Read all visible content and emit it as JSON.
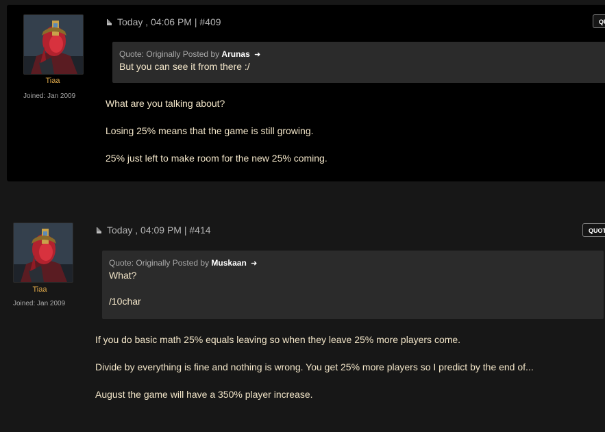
{
  "posts": [
    {
      "username": "Tiaa",
      "joined": "Joined: Jan 2009",
      "meta": "Today , 04:06 PM | #409",
      "quote_button": "QU",
      "quote": {
        "prefix": "Quote: Originally Posted by",
        "author": "Arunas",
        "lines": [
          "But you can see it from there :/"
        ]
      },
      "body": [
        "What are you talking about?",
        "Losing 25% means that the game is still growing.",
        "25% just left to make room for the new 25% coming."
      ]
    },
    {
      "username": "Tiaa",
      "joined": "Joined: Jan 2009",
      "meta": "Today , 04:09 PM | #414",
      "quote_button": "QUOTE",
      "quote": {
        "prefix": "Quote: Originally Posted by",
        "author": "Muskaan",
        "lines": [
          "What?",
          "/10char"
        ]
      },
      "body": [
        "If you do basic math 25% equals leaving so when they leave 25% more players come.",
        "Divide by everything is fine and nothing is wrong. You get 25% more players so I predict by the end of...",
        "August the game will have a 350% player increase."
      ]
    }
  ],
  "colors": {
    "page_bg": "#171717",
    "post_bg": "#000000",
    "quote_bg": "#2b2b2b",
    "username": "#e0a94a",
    "body_text": "#f3e6c9"
  },
  "icons": {
    "post_icon": "document-icon",
    "view_post": "arrow-right-icon"
  }
}
